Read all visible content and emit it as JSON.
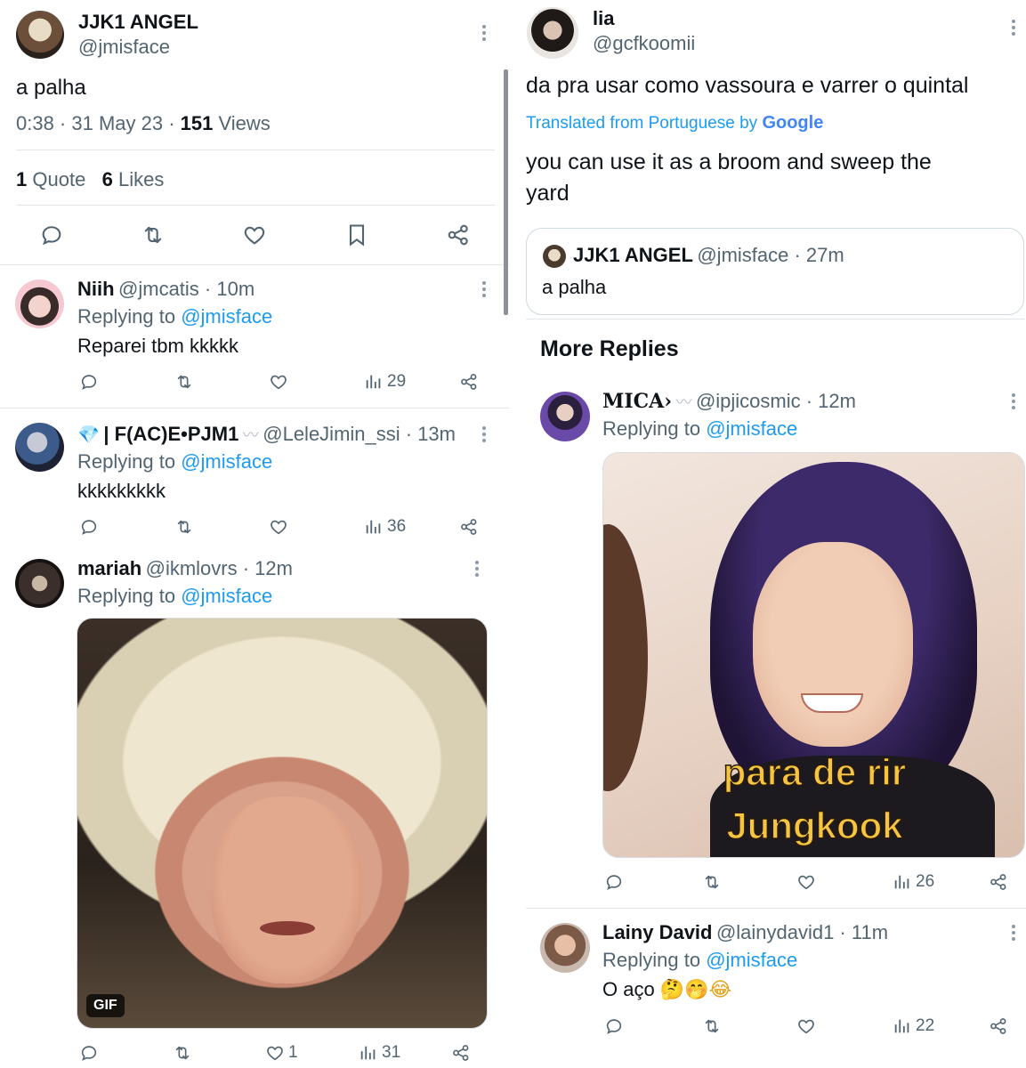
{
  "left": {
    "main_tweet": {
      "name": "JJK1 ANGEL",
      "handle": "@jmisface",
      "text": "a palha",
      "meta_prefix": "0:38 · 31 May 23 · ",
      "views_count": "151",
      "views_label": " Views",
      "quote_count": "1",
      "quote_label": "Quote",
      "likes_count": "6",
      "likes_label": "Likes"
    },
    "replies": [
      {
        "name": "Niih",
        "handle": "@jmcatis · 10m",
        "replying_prefix": "Replying to ",
        "replying_to": "@jmisface",
        "text": "Reparei tbm kkkkk",
        "views": "29"
      },
      {
        "name": "| F(AC)E•PJM1",
        "name_emoji": "💎",
        "handle": "@LeleJimin_ssi · 13m",
        "replying_prefix": "Replying to ",
        "replying_to": "@jmisface",
        "text": "kkkkkkkkk",
        "views": "36"
      },
      {
        "name": "mariah",
        "handle": "@ikmlovrs · 12m",
        "replying_prefix": "Replying to ",
        "replying_to": "@jmisface",
        "media_badge": "GIF",
        "likes": "1",
        "views": "31"
      }
    ]
  },
  "right": {
    "main_tweet": {
      "name": "lia",
      "handle": "@gcfkoomii",
      "text": "da pra usar como vassoura e varrer o quintal",
      "translated_from": "Translated from Portuguese by ",
      "translator": "Google",
      "translation_line1": "you can use it as a broom and sweep the",
      "translation_line2": "yard"
    },
    "quoted": {
      "name": "JJK1 ANGEL",
      "handle": "@jmisface · 27m",
      "text": "a palha"
    },
    "section_title": "More Replies",
    "replies": [
      {
        "name": "MICA›",
        "handle": "@ipjicosmic · 12m",
        "replying_prefix": "Replying to ",
        "replying_to": "@jmisface",
        "caption_line1": "para de rir",
        "caption_line2": "Jungkook",
        "views": "26"
      },
      {
        "name": "Lainy David",
        "handle": "@lainydavid1 · 11m",
        "replying_prefix": "Replying to ",
        "replying_to": "@jmisface",
        "text": "O aço",
        "emojis": "🤔🤭😂",
        "views": "22"
      }
    ]
  },
  "colors": {
    "link": "#1d9bf0",
    "secondary_text": "#536471",
    "primary_text": "#0f1419",
    "divider": "#e1e6ea"
  }
}
